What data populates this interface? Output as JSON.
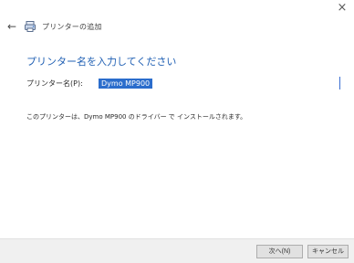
{
  "window": {
    "close_glyph": "×",
    "back_glyph": "←",
    "title": "プリンターの追加"
  },
  "main": {
    "heading": "プリンター名を入力してください",
    "printer_name_label": "プリンター名(P):",
    "printer_name_value": "Dymo MP900",
    "info_text": "このプリンターは、Dymo MP900 のドライバー  で インストールされます。"
  },
  "footer": {
    "next_label": "次へ(N)",
    "cancel_label": "キャンセル"
  },
  "colors": {
    "heading": "#1f5fb3",
    "selection": "#2b6dcc",
    "footer_bg": "#f0f0f0"
  },
  "icons": {
    "back": "back-arrow-icon",
    "printer": "printer-icon",
    "close": "close-icon"
  }
}
